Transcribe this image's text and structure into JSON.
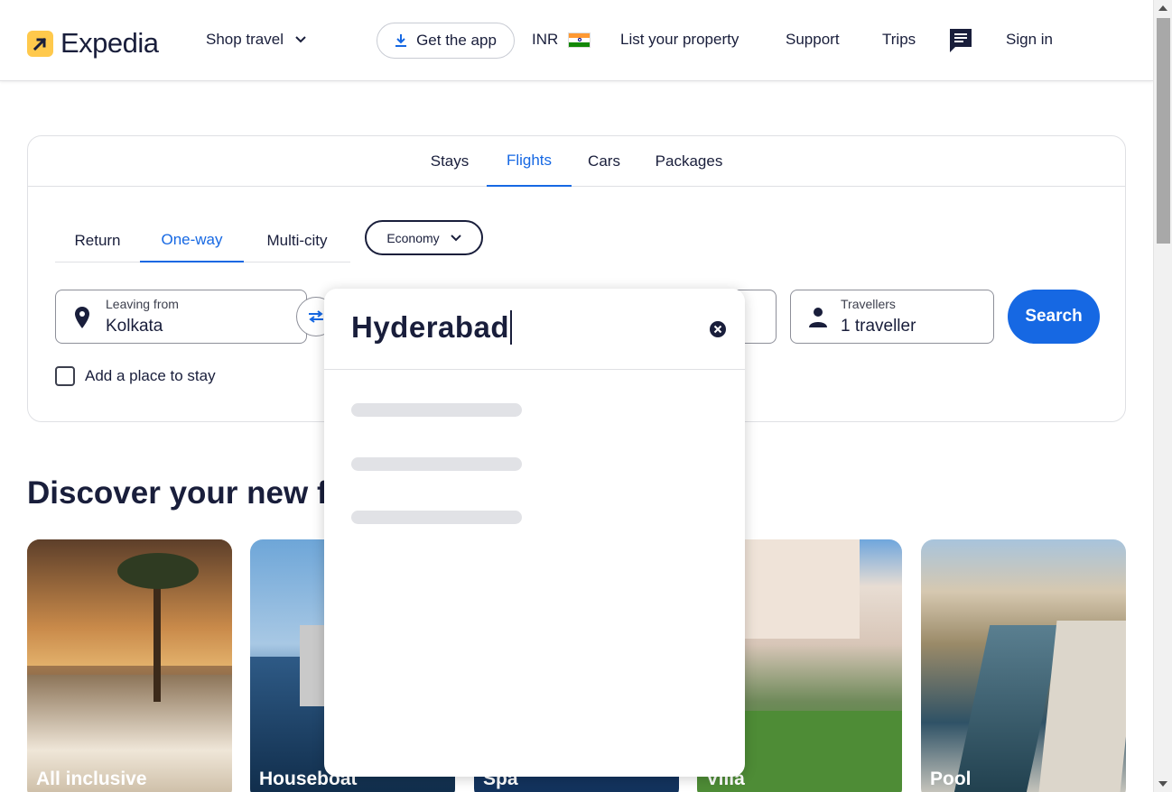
{
  "header": {
    "logo_text": "Expedia",
    "shop_travel": "Shop travel",
    "get_app": "Get the app",
    "currency": "INR",
    "list_property": "List your property",
    "support": "Support",
    "trips": "Trips",
    "sign_in": "Sign in"
  },
  "tabs": {
    "stays": "Stays",
    "flights": "Flights",
    "cars": "Cars",
    "packages": "Packages",
    "active": "Flights"
  },
  "flight_types": {
    "return": "Return",
    "one_way": "One-way",
    "multi_city": "Multi-city",
    "active": "One-way"
  },
  "cabin_class": "Economy",
  "leaving": {
    "label": "Leaving from",
    "value": "Kolkata"
  },
  "travellers": {
    "label": "Travellers",
    "value": "1 traveller"
  },
  "search_button": "Search",
  "add_place": "Add a place to stay",
  "dropdown": {
    "input_value": "Hyderabad"
  },
  "discover": {
    "title": "Discover your new fa",
    "cards": [
      {
        "label": "All inclusive"
      },
      {
        "label": "Houseboat"
      },
      {
        "label": "Spa"
      },
      {
        "label": "Villa"
      },
      {
        "label": "Pool"
      }
    ]
  },
  "colors": {
    "accent": "#1668e3",
    "text": "#191e3b",
    "logo_yellow": "#ffc94c"
  }
}
